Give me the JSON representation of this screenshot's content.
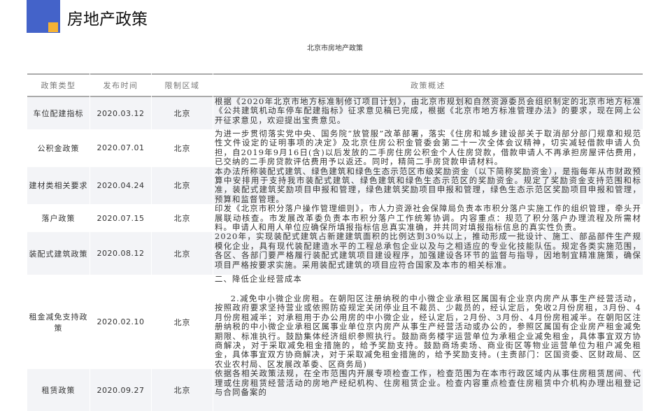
{
  "page_title": "房地产政策",
  "table_title": "北京市房地产政策",
  "columns": [
    "政策类型",
    "发布时间",
    "限制区域",
    "政策概述"
  ],
  "rows": [
    {
      "type": "车位配建指标",
      "date": "2020.03.12",
      "region": "北京",
      "desc": "根据《2020年北京市地方标准制修订项目计划》，由北京市规划和自然资源委员会组织制定的北京市地方标准《公共建筑机动车停车配建指标》征求意见稿已完成，根据《北京市地方标准管理办法》的要求，现在网上公开征求意见，欢迎提出宝贵意见。"
    },
    {
      "type": "公积金政策",
      "date": "2020.07.01",
      "region": "北京",
      "desc": "为进一步贯彻落实党中央、国务院“放管服”改革部署，落实《住房和城乡建设部关于取消部分部门规章和规范性文件设定的证明事项的决定》及北京住房公积金管委会第二十一次全体会议精神，切实减轻借款申请人负担，自2019年9月16日(含)以后发放的二手房住房公积金个人住房贷款，借款申请人不再承担房屋评估费用，已交纳的二手房贷款评估费用予以返还。同时，精简二手房贷款申请材料。"
    },
    {
      "type": "建材类相关要求",
      "date": "2020.04.24",
      "region": "北京",
      "desc": "本办法所称装配式建筑、绿色建筑和绿色生态示范区市级奖励资金（以下简称奖励资金），是指每年从市财政预算中安排用于支持我市装配式建筑、绿色建筑和绿色生态示范区的奖励资金。规定了奖励资金支持范围和标准，装配式建筑奖励项目申报和管理，绿色建筑奖励项目申报和管理，绿色生态示范区奖励项目申报和管理，预算和监督管理。"
    },
    {
      "type": "落户政策",
      "date": "2020.07.15",
      "region": "北京",
      "desc": "印发《北京市积分落户操作管理细则》，市人力资源社会保障局负责本市积分落户实施工作的组织管理，牵头开展联动核查。市发展改革委负责本市积分落户工作统筹协调。内容重点：规范了积分落户办理流程及所需材料。申请人和用人单位应确保所填报指标信息真实准确，并共同对填报指标信息的真实性负责。"
    },
    {
      "type": "装配式建筑政策",
      "date": "2020.08.12",
      "region": "北京",
      "desc": "2020年，实现装配式建筑占新建建筑面积的比例达到30%以上，推动形成一批设计、施工、部品部件生产规模化企业，具有现代装配建造水平的工程总承包企业以及与之相适应的专业化技能队伍。规定各类实施范围，各区、各部门要严格履行装配式建筑项目建设程序，加强建设各环节的监督与指导，因地制宜精准施策，确保项目严格按要求实施。采用装配式建筑的项目应符合国家及本市的相关标准。"
    },
    {
      "type": "租金减免支持政策",
      "date": "2020.02.10",
      "region": "北京",
      "desc_heading": "二、降低企业经营成本",
      "desc": "2.减免中小微企业房租。在朝阳区注册纳税的中小微企业承租区属国有企业京内房产从事生产经营活动，按照政府要求坚持营业或依照防疫规定关闭停业且不裁员、少裁员的，经认定后，免收2月份房租，3月份、4月份房租减半；对承租用于办公用房的中小微企业，经认定后，2月份、3月份、4月份房租减半。在朝阳区注册纳税的中小微企业承租区属事业单位京内房产从事生产经营活动或办公的，参照区属国有企业房产租金减免期限、标准执行。鼓励集体经济组织参照执行。鼓励商务楼宇运营单位为承租企业减免租金，具体事宜双方协商解决，对于采取减免租金措施的，给予奖励支持。鼓励商场卖场、商业街区等物业运营单位为租户减免租金，具体事宜双方协商解决，对于采取减免租金措施的，给予奖励支持。(主责部门：区国资委、区财政局、区农业农村局、区发展改革委、区商务局)"
    },
    {
      "type": "租赁政策",
      "date": "2020.09.27",
      "region": "北京",
      "desc": "依据各相关政策法规，在全市范围内开展专项检查工作，检查范围为在本市行政区域内从事住房租赁居间、代理或住房租赁经营活动的房地产经纪机构、住房租赁企业。检查内容重点检查住房租赁中介机构办理出租登记与合同备案的"
    }
  ],
  "colors": {
    "blue": "#4463c9",
    "orange": "#f5b335"
  }
}
